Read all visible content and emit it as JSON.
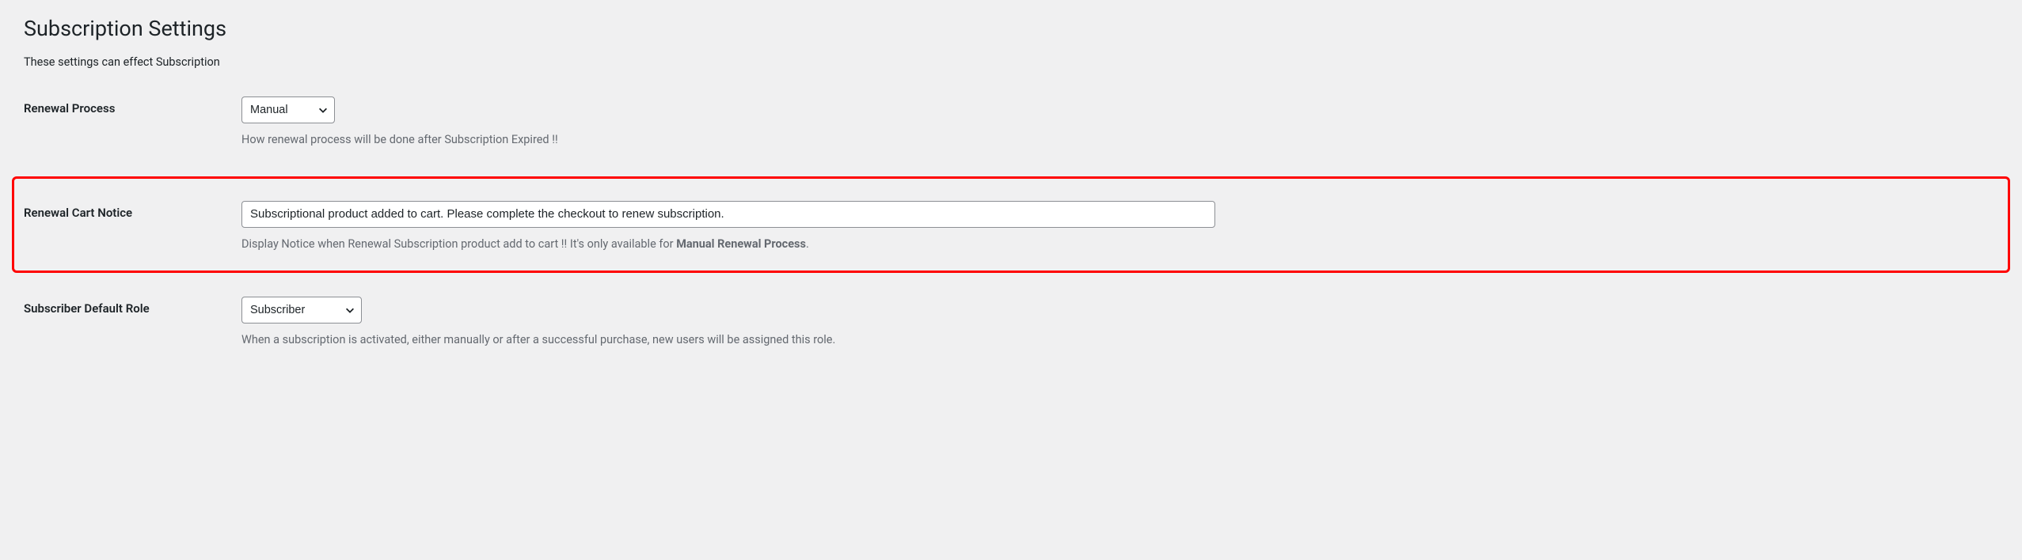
{
  "page": {
    "title": "Subscription Settings",
    "subtitle": "These settings can effect Subscription"
  },
  "fields": {
    "renewal_process": {
      "label": "Renewal Process",
      "value": "Manual",
      "description": "How renewal process will be done after Subscription Expired !!"
    },
    "renewal_cart_notice": {
      "label": "Renewal Cart Notice",
      "value": "Subscriptional product added to cart. Please complete the checkout to renew subscription.",
      "description_prefix": "Display Notice when Renewal Subscription product add to cart !! It's only available for ",
      "description_bold": "Manual Renewal Process",
      "description_suffix": "."
    },
    "subscriber_default_role": {
      "label": "Subscriber Default Role",
      "value": "Subscriber",
      "description": "When a subscription is activated, either manually or after a successful purchase, new users will be assigned this role."
    }
  }
}
